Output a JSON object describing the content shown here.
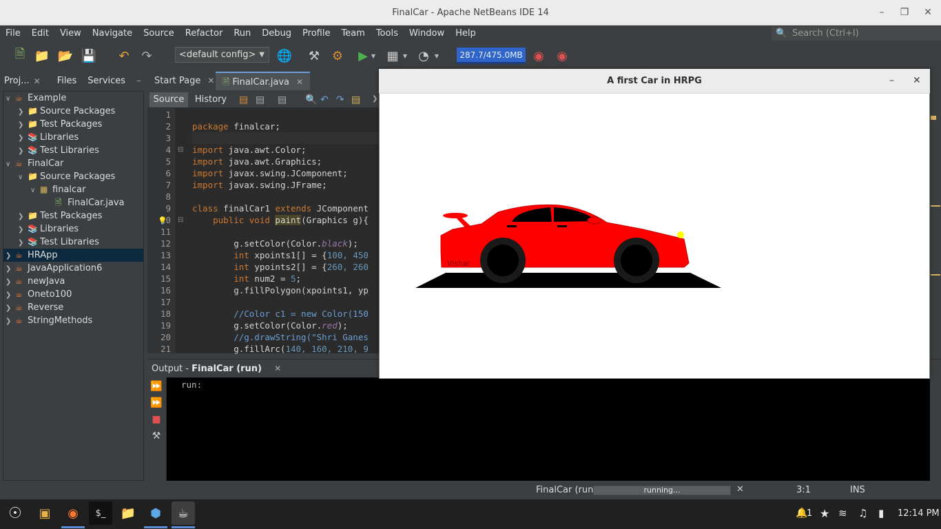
{
  "window": {
    "title": "FinalCar - Apache NetBeans IDE 14"
  },
  "menu": [
    "File",
    "Edit",
    "View",
    "Navigate",
    "Source",
    "Refactor",
    "Run",
    "Debug",
    "Profile",
    "Team",
    "Tools",
    "Window",
    "Help"
  ],
  "search": {
    "placeholder": "Search (Ctrl+I)"
  },
  "toolbar": {
    "config": "<default config>",
    "memory": "287.7/475.0MB"
  },
  "left_panel": {
    "tabs": [
      "Proj...",
      "Files",
      "Services"
    ],
    "tree": [
      {
        "label": "Example"
      },
      {
        "label": "Source Packages"
      },
      {
        "label": "Test Packages"
      },
      {
        "label": "Libraries"
      },
      {
        "label": "Test Libraries"
      },
      {
        "label": "FinalCar"
      },
      {
        "label": "Source Packages"
      },
      {
        "label": "finalcar"
      },
      {
        "label": "FinalCar.java"
      },
      {
        "label": "Test Packages"
      },
      {
        "label": "Libraries"
      },
      {
        "label": "Test Libraries"
      },
      {
        "label": "HRApp"
      },
      {
        "label": "JavaApplication6"
      },
      {
        "label": "newJava"
      },
      {
        "label": "Oneto100"
      },
      {
        "label": "Reverse"
      },
      {
        "label": "StringMethods"
      }
    ]
  },
  "editor": {
    "tabs": [
      "Start Page",
      "FinalCar.java"
    ],
    "modes": [
      "Source",
      "History"
    ],
    "line_numbers": [
      "1",
      "2",
      "3",
      "4",
      "5",
      "6",
      "7",
      "8",
      "9",
      "10",
      "11",
      "12",
      "13",
      "14",
      "15",
      "16",
      "17",
      "18",
      "19",
      "20",
      "21"
    ],
    "lines": {
      "l2a": "package",
      "l2b": " finalcar;",
      "l4a": "import",
      "l4b": " java.awt.Color;",
      "l5a": "import",
      "l5b": " java.awt.Graphics;",
      "l6a": "import",
      "l6b": " javax.swing.JComponent;",
      "l7a": "import",
      "l7b": " javax.swing.JFrame;",
      "l9a": "class",
      "l9b": " finalCar1 ",
      "l9c": "extends",
      "l9d": " JComponent",
      "l10a": "    public void ",
      "l10b": "paint",
      "l10c": "(Graphics g){",
      "l12a": "        g.setColor(Color.",
      "l12b": "black",
      "l12c": ");",
      "l13a": "        int",
      "l13b": " xpoints1[] = {",
      "l13c": "100, 450",
      "l14a": "        int",
      "l14b": " ypoints2[] = {",
      "l14c": "260, 260",
      "l15a": "        int",
      "l15b": " num2 = ",
      "l15c": "5",
      "l15d": ";",
      "l16": "        g.fillPolygon(xpoints1, yp",
      "l18": "        //Color c1 = new Color(150",
      "l19a": "        g.setColor(Color.",
      "l19b": "red",
      "l19c": ");",
      "l20": "        //g.drawString(\"Shri Ganes",
      "l21a": "        g.fillArc(",
      "l21b": "140, 160, 210, 9"
    }
  },
  "car_window": {
    "title": "A first Car in HRPG",
    "car_label": "Vishal"
  },
  "output": {
    "tab_prefix": "Output - ",
    "tab_name": "FinalCar (run)",
    "text": "run:"
  },
  "status": {
    "task": "FinalCar (run)",
    "progress": "running...",
    "position": "3:1",
    "mode": "INS"
  },
  "taskbar": {
    "time": "12:14 PM",
    "notification_count": "1"
  },
  "colors": {
    "accent": "#2f65ca",
    "car_body": "#ff0000",
    "headlight": "#ffff00"
  }
}
